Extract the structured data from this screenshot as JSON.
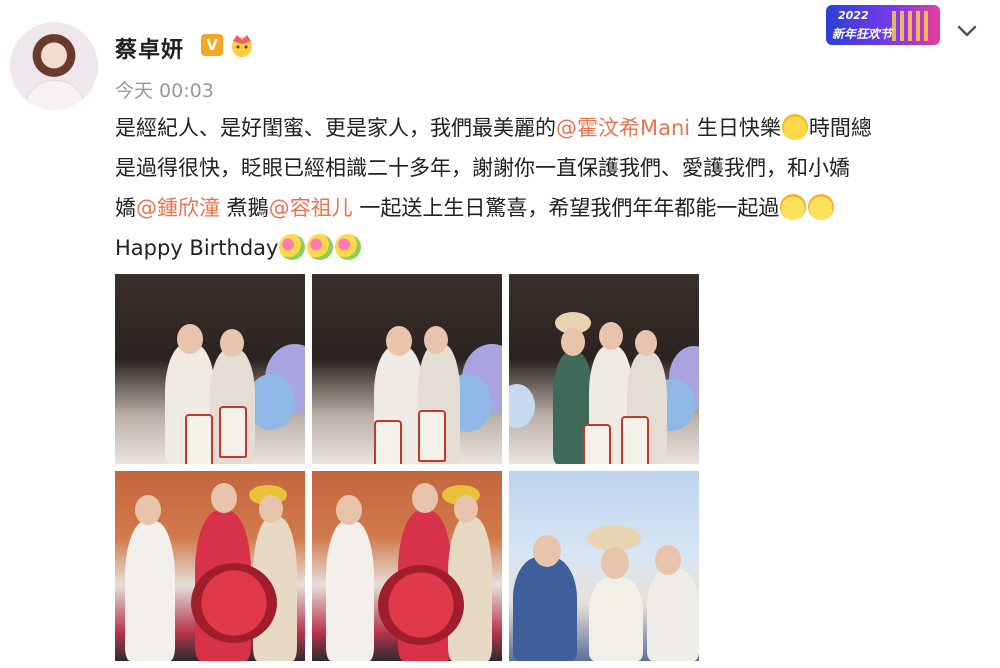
{
  "user": {
    "name": "蔡卓妍",
    "verified_badge": "V",
    "badge_icon": "crown-icon",
    "time": "今天 00:03"
  },
  "promo": {
    "year": "2022",
    "label": "新年狂欢节"
  },
  "menu_icon": "chevron-down-icon",
  "post": {
    "line1_a": "是經紀人、是好閨蜜、更是家人，我們最美麗的",
    "mention1": "@霍汶希Mani",
    "line1_b": " 生日快樂",
    "line1_c": "時間總",
    "line2": "是過得很快，眨眼已經相識二十多年，謝謝你一直保護我們、愛護我們，和小嬌",
    "line3_a": "嬌",
    "mention2": "@鍾欣潼",
    "line3_b": " 煮鵝",
    "mention3": "@容祖儿",
    "line3_c": " 一起送上生日驚喜，希望我們年年都能一起過",
    "line4": "Happy Birthday"
  },
  "colors": {
    "mention": "#eb7350",
    "time": "#9a9a9a",
    "badge": "#f6a623"
  },
  "photos": [
    {
      "name": "photo-1"
    },
    {
      "name": "photo-2"
    },
    {
      "name": "photo-3"
    },
    {
      "name": "photo-4"
    },
    {
      "name": "photo-5"
    },
    {
      "name": "photo-6"
    }
  ]
}
